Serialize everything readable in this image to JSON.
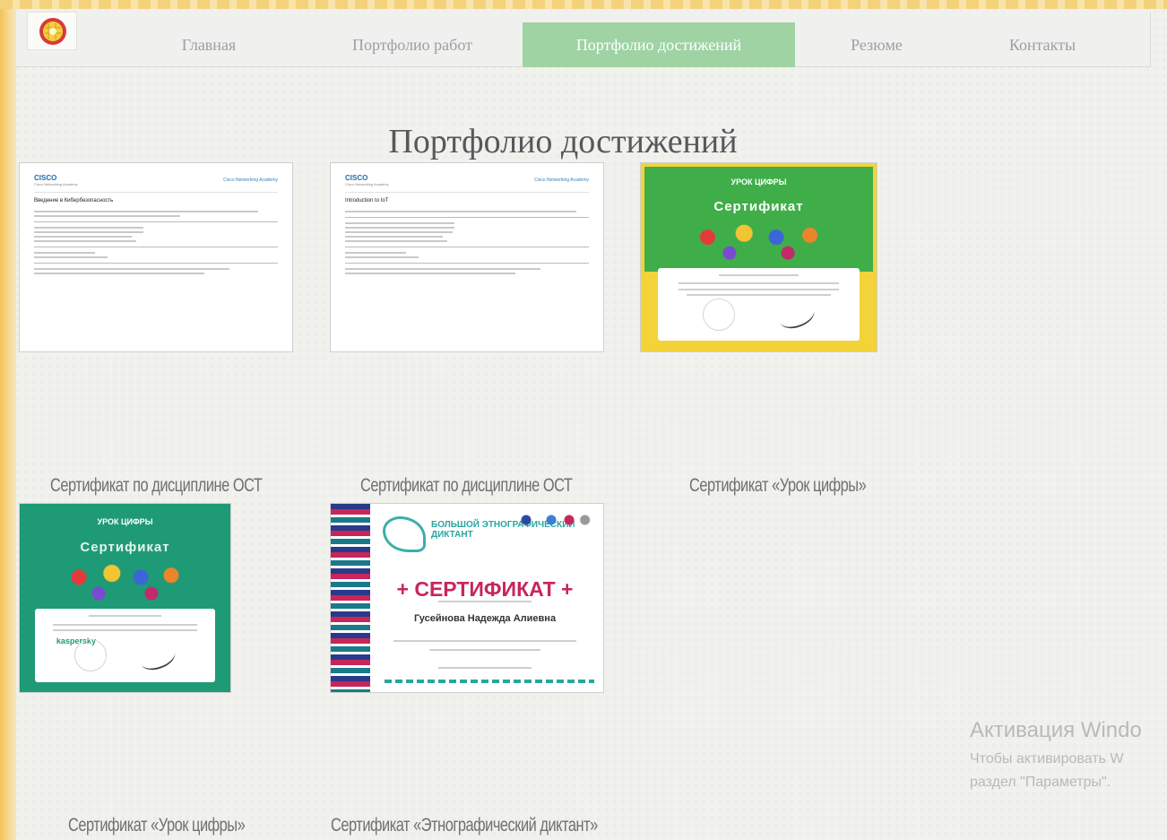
{
  "nav": {
    "items": [
      {
        "label": "Главная"
      },
      {
        "label": "Портфолио работ"
      },
      {
        "label": "Портфолио достижений",
        "active": true
      },
      {
        "label": "Резюме"
      },
      {
        "label": "Контакты"
      }
    ]
  },
  "main": {
    "title": "Портфолио достижений",
    "certificates": [
      {
        "caption": "Сертификат по дисциплине ОСТ",
        "doc_title": "Введение в Кибербезопасность"
      },
      {
        "caption": "Сертификат по дисциплине ОСТ",
        "doc_title": "Introduction to IoT"
      },
      {
        "caption": "Сертификат «Урок цифры»",
        "word": "Сертификат"
      },
      {
        "caption": "Сертификат «Урок цифры»",
        "word": "Сертификат",
        "sponsor": "kaspersky"
      },
      {
        "caption": "Сертификат «Этнографический диктант»",
        "word": "+ СЕРТИФИКАТ +",
        "name": "Гусейнова Надежда Алиевна",
        "event": "БОЛЬШОЙ ЭТНОГРАФИЧЕСКИЙ ДИКТАНТ"
      }
    ]
  },
  "cert_brand": {
    "cisco": "CISCO",
    "cisco_academy": "Cisco Networking Academy",
    "urok_label": "УРОК ЦИФРЫ"
  },
  "watermark": {
    "title": "Активация Windo",
    "line1": "Чтобы активировать W",
    "line2": "раздел \"Параметры\"."
  },
  "colors": {
    "nav_active": "#9fd3a4",
    "urok_green_1": "#3fae49",
    "urok_green_2": "#1f9a76",
    "dictation_accent": "#c8265a"
  }
}
